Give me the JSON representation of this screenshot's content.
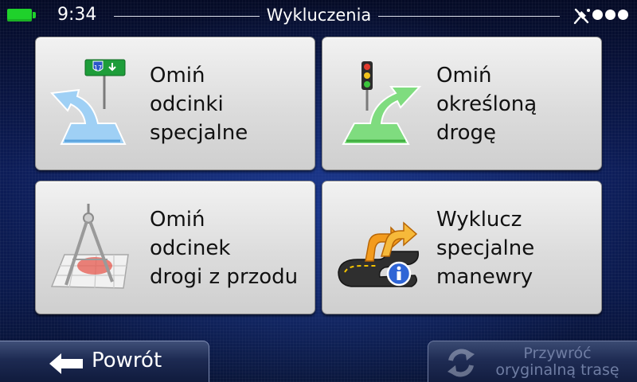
{
  "status": {
    "time": "9:34",
    "title": "Wykluczenia"
  },
  "tiles": [
    {
      "icon": "highway-road-avoid-icon",
      "lines": [
        "Omiń",
        "odcinki",
        "specjalne"
      ],
      "sign_number": "17"
    },
    {
      "icon": "traffic-light-road-avoid-icon",
      "lines": [
        "Omiń",
        "określoną",
        "drogę"
      ]
    },
    {
      "icon": "map-compass-section-icon",
      "lines": [
        "Omiń",
        "odcinek",
        "drogi z przodu"
      ]
    },
    {
      "icon": "special-maneuver-info-icon",
      "lines": [
        "Wyklucz",
        "specjalne",
        "manewry"
      ]
    }
  ],
  "footer": {
    "back_label": "Powrót",
    "restore_lines": [
      "Przywróć",
      "oryginalną trasę"
    ],
    "restore_enabled": false
  },
  "colors": {
    "battery": "#1fd12b",
    "tile": "#dcdcdc",
    "background": "#0d1d58",
    "disabled_text": "#6f7da3"
  }
}
